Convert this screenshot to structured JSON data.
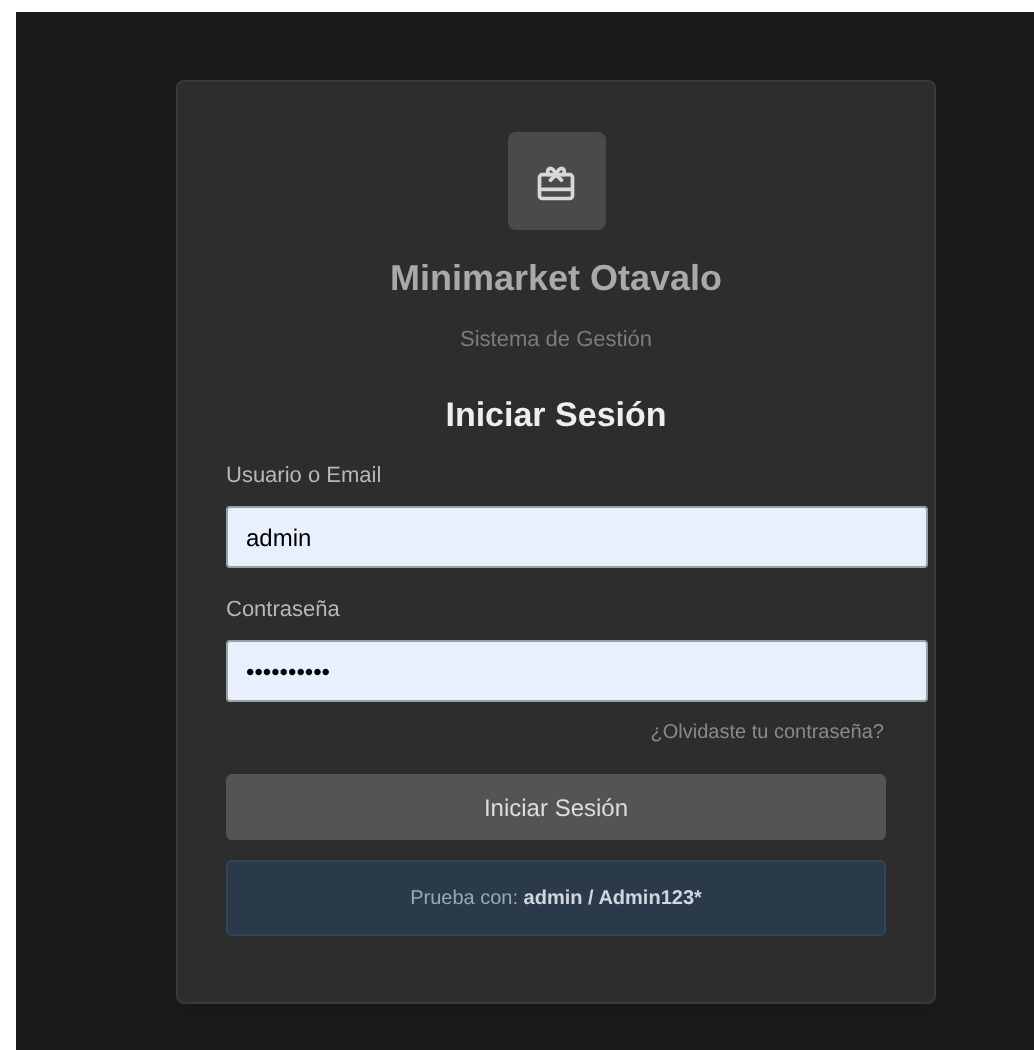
{
  "brand": {
    "title": "Minimarket Otavalo",
    "subtitle": "Sistema de Gestión"
  },
  "form": {
    "heading": "Iniciar Sesión",
    "fields": [
      {
        "label": "Usuario o Email",
        "value": "admin"
      },
      {
        "label": "Contraseña",
        "value": "••••••••••"
      }
    ],
    "forgot_link": "¿Olvidaste tu contraseña?",
    "submit": "Iniciar Sesión",
    "hint": {
      "text": "Prueba con:",
      "credentials": "admin / Admin123*"
    }
  }
}
